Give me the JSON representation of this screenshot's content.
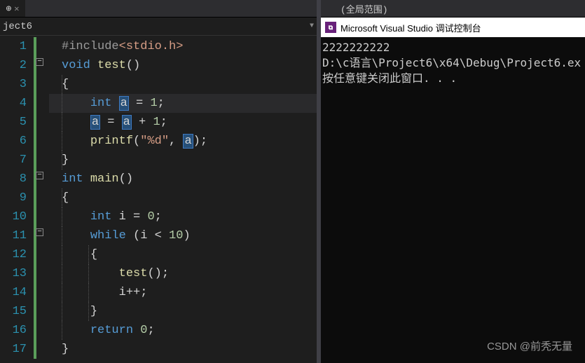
{
  "breadcrumb": {
    "project": "ject6"
  },
  "scope": {
    "label": "(全局范围)"
  },
  "console": {
    "title": "Microsoft Visual Studio 调试控制台",
    "line1": "2222222222",
    "line2": "D:\\c语言\\Project6\\x64\\Debug\\Project6.ex",
    "line3": "按任意键关闭此窗口. . ."
  },
  "watermark": "CSDN @前秃无量",
  "lines": [
    {
      "n": "1"
    },
    {
      "n": "2"
    },
    {
      "n": "3"
    },
    {
      "n": "4"
    },
    {
      "n": "5"
    },
    {
      "n": "6"
    },
    {
      "n": "7"
    },
    {
      "n": "8"
    },
    {
      "n": "9"
    },
    {
      "n": "10"
    },
    {
      "n": "11"
    },
    {
      "n": "12"
    },
    {
      "n": "13"
    },
    {
      "n": "14"
    },
    {
      "n": "15"
    },
    {
      "n": "16"
    },
    {
      "n": "17"
    }
  ],
  "code": {
    "include_kw": "#include",
    "include_arg": "<stdio.h>",
    "void": "void",
    "int": "int",
    "while": "while",
    "return": "return",
    "test": "test",
    "main": "main",
    "printf": "printf",
    "a": "a",
    "i": "i",
    "one": "1",
    "zero": "0",
    "ten": "10",
    "fmt": "\"%d\""
  }
}
